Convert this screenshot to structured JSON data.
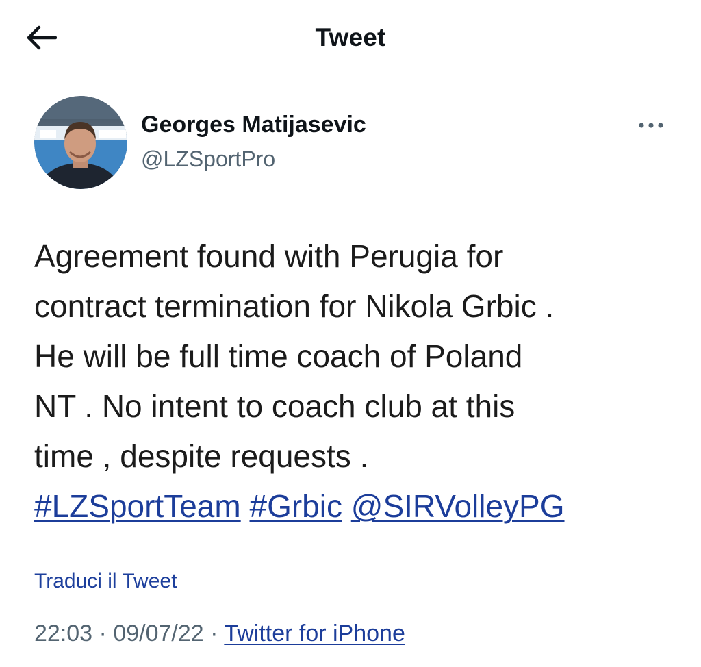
{
  "header": {
    "title": "Tweet",
    "back_icon": "arrow-left-icon"
  },
  "author": {
    "display_name": "Georges Matijasevic",
    "handle": "@LZSportPro",
    "avatar_icon": "profile-photo",
    "more_icon": "more-horizontal-icon"
  },
  "tweet": {
    "lines": [
      "Agreement found with Perugia for",
      "contract termination for Nikola Grbic .",
      "He will be full time coach of Poland",
      "NT . No intent to coach club at this",
      "time , despite requests ."
    ],
    "tags": [
      "#LZSportTeam",
      "#Grbic",
      "@SIRVolleyPG"
    ]
  },
  "translate_label": "Traduci il Tweet",
  "meta": {
    "time": "22:03",
    "sep1": "·",
    "date": "09/07/22",
    "sep2": "·",
    "source": "Twitter for iPhone"
  },
  "colors": {
    "link": "#1c3d9a",
    "secondary_text": "#536471",
    "primary_text": "#0f1419"
  }
}
